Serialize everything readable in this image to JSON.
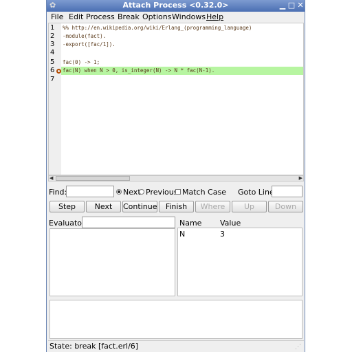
{
  "window": {
    "title": "Attach Process <0.32.0>"
  },
  "menu": {
    "items": [
      "File",
      "Edit",
      "Process",
      "Break",
      "Options",
      "Windows",
      "Help"
    ]
  },
  "editor": {
    "lines": [
      {
        "num": "1",
        "text": "%% http://en.wikipedia.org/wiki/Erlang_(programming_language)"
      },
      {
        "num": "2",
        "text": "-module(fact)."
      },
      {
        "num": "3",
        "text": "-export([fac/1])."
      },
      {
        "num": "4",
        "text": ""
      },
      {
        "num": "5",
        "text": "fac(0) -> 1;"
      },
      {
        "num": "6",
        "text": "fac(N) when N > 0, is_integer(N) -> N * fac(N-1)."
      },
      {
        "num": "7",
        "text": ""
      }
    ],
    "current_line": 6,
    "breakpoint_line": 6,
    "highlight_color": "#b7f5a1"
  },
  "find": {
    "label": "Find:",
    "value": "",
    "next_label": "Next",
    "previous_label": "Previous",
    "match_case_label": "Match Case",
    "goto_label": "Goto Line:",
    "goto_value": ""
  },
  "buttons": {
    "step": "Step",
    "next": "Next",
    "continue": "Continue",
    "finish": "Finish",
    "where": "Where",
    "up": "Up",
    "down": "Down"
  },
  "evaluator": {
    "label": "Evaluator:",
    "value": ""
  },
  "bindings": {
    "headers": {
      "name": "Name",
      "value": "Value"
    },
    "rows": [
      {
        "name": "N",
        "value": "3"
      }
    ]
  },
  "status": {
    "text": "State: break [fact.erl/6]"
  }
}
